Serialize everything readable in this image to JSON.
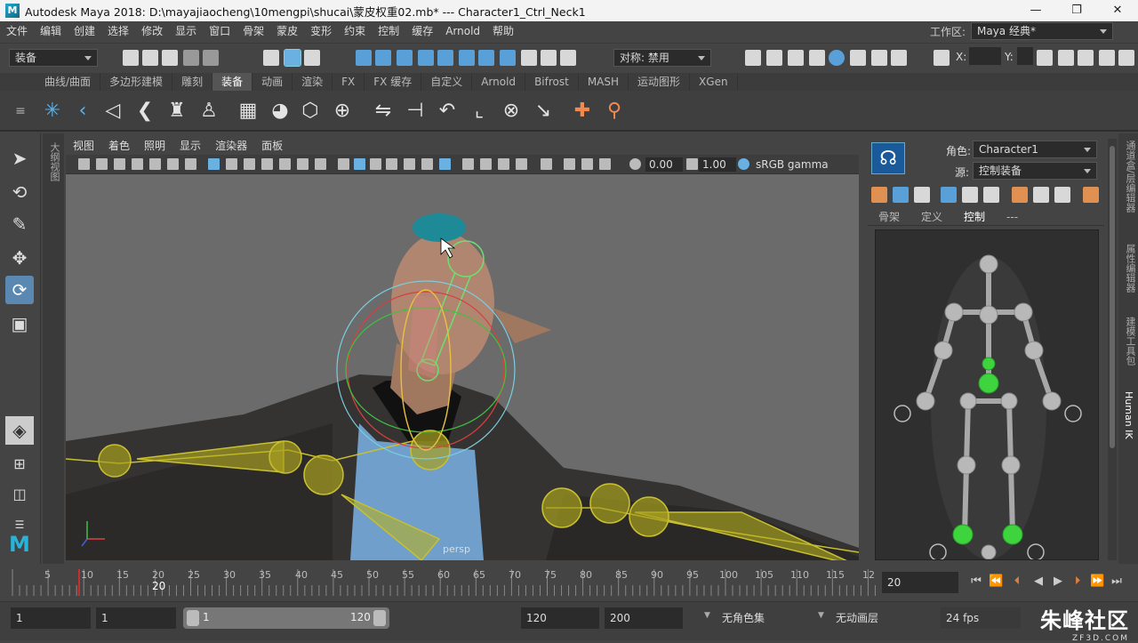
{
  "titlebar": {
    "app_title": "Autodesk Maya 2018: D:\\mayajiaocheng\\10mengpi\\shucai\\蒙皮权重02.mb*   ---   Character1_Ctrl_Neck1",
    "minimize": "—",
    "maximize": "❐",
    "close": "✕"
  },
  "menubar": {
    "items": [
      "文件",
      "编辑",
      "创建",
      "选择",
      "修改",
      "显示",
      "窗口",
      "骨架",
      "蒙皮",
      "变形",
      "约束",
      "控制",
      "缓存",
      "Arnold",
      "帮助"
    ],
    "workspace_label": "工作区:",
    "workspace_value": "Maya 经典*"
  },
  "status": {
    "menuset": "装备",
    "symmetry": "对称: 禁用",
    "x_label": "X:",
    "y_label": "Y:"
  },
  "shelf_tabs": [
    "曲线/曲面",
    "多边形建模",
    "雕刻",
    "装备",
    "动画",
    "渲染",
    "FX",
    "FX 缓存",
    "自定义",
    "Arnold",
    "Bifrost",
    "MASH",
    "运动图形",
    "XGen"
  ],
  "viewport": {
    "menus": [
      "视图",
      "着色",
      "照明",
      "显示",
      "渲染器",
      "面板"
    ],
    "exposure": "0.00",
    "gamma": "1.00",
    "colorspace": "sRGB gamma",
    "camera_label": "persp"
  },
  "outliner_tab": "大纲视图",
  "hik": {
    "character_label": "角色:",
    "character_value": "Character1",
    "source_label": "源:",
    "source_value": "控制装备",
    "tabs": [
      "骨架",
      "定义",
      "控制",
      "---"
    ]
  },
  "side_tabs": [
    "通道盒/层编辑器",
    "属性编辑器",
    "建模工具包",
    "Human IK"
  ],
  "timeline": {
    "ticks": [
      "5",
      "10",
      "15",
      "20",
      "25",
      "30",
      "35",
      "40",
      "45",
      "50",
      "55",
      "60",
      "65",
      "70",
      "75",
      "80",
      "85",
      "90",
      "95",
      "100",
      "105",
      "110",
      "115",
      "12"
    ],
    "current_marker": "20",
    "current_frame": "20"
  },
  "range": {
    "start": "1",
    "start2": "1",
    "slider_start": "1",
    "slider_end": "120",
    "end": "120",
    "end2": "200",
    "charset": "无角色集",
    "animlayer": "无动画层",
    "fps": "24 fps"
  },
  "watermark": {
    "text": "朱峰社区",
    "sub": "ZF3D.COM"
  }
}
